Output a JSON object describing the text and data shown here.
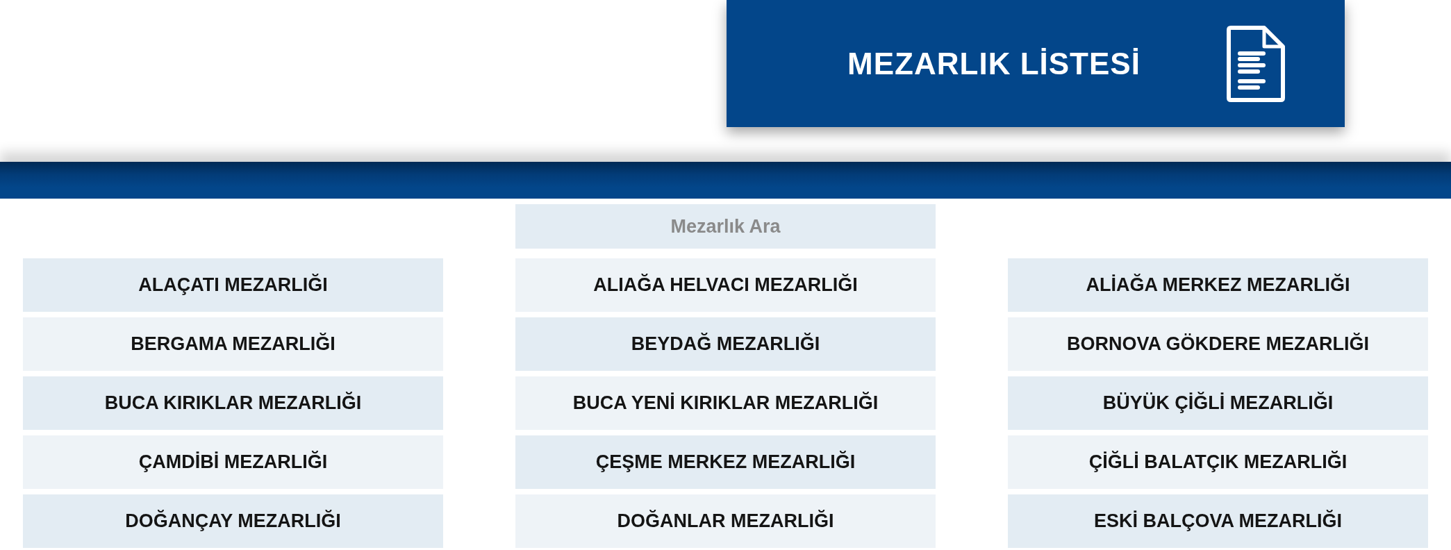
{
  "header": {
    "title": "MEZARLIK LİSTESİ"
  },
  "search": {
    "placeholder": "Mezarlık Ara"
  },
  "cemeteries": [
    "ALAÇATI MEZARLIĞI",
    "ALIAĞA HELVACI MEZARLIĞI",
    "ALİAĞA MERKEZ MEZARLIĞI",
    "BERGAMA MEZARLIĞI",
    "BEYDAĞ MEZARLIĞI",
    "BORNOVA GÖKDERE MEZARLIĞI",
    "BUCA KIRIKLAR MEZARLIĞI",
    "BUCA YENİ KIRIKLAR MEZARLIĞI",
    "BÜYÜK ÇİĞLİ MEZARLIĞI",
    "ÇAMDİBİ MEZARLIĞI",
    "ÇEŞME MERKEZ MEZARLIĞI",
    "ÇİĞLİ BALATÇIK MEZARLIĞI",
    "DOĞANÇAY MEZARLIĞI",
    "DOĞANLAR MEZARLIĞI",
    "ESKİ BALÇOVA MEZARLIĞI"
  ]
}
